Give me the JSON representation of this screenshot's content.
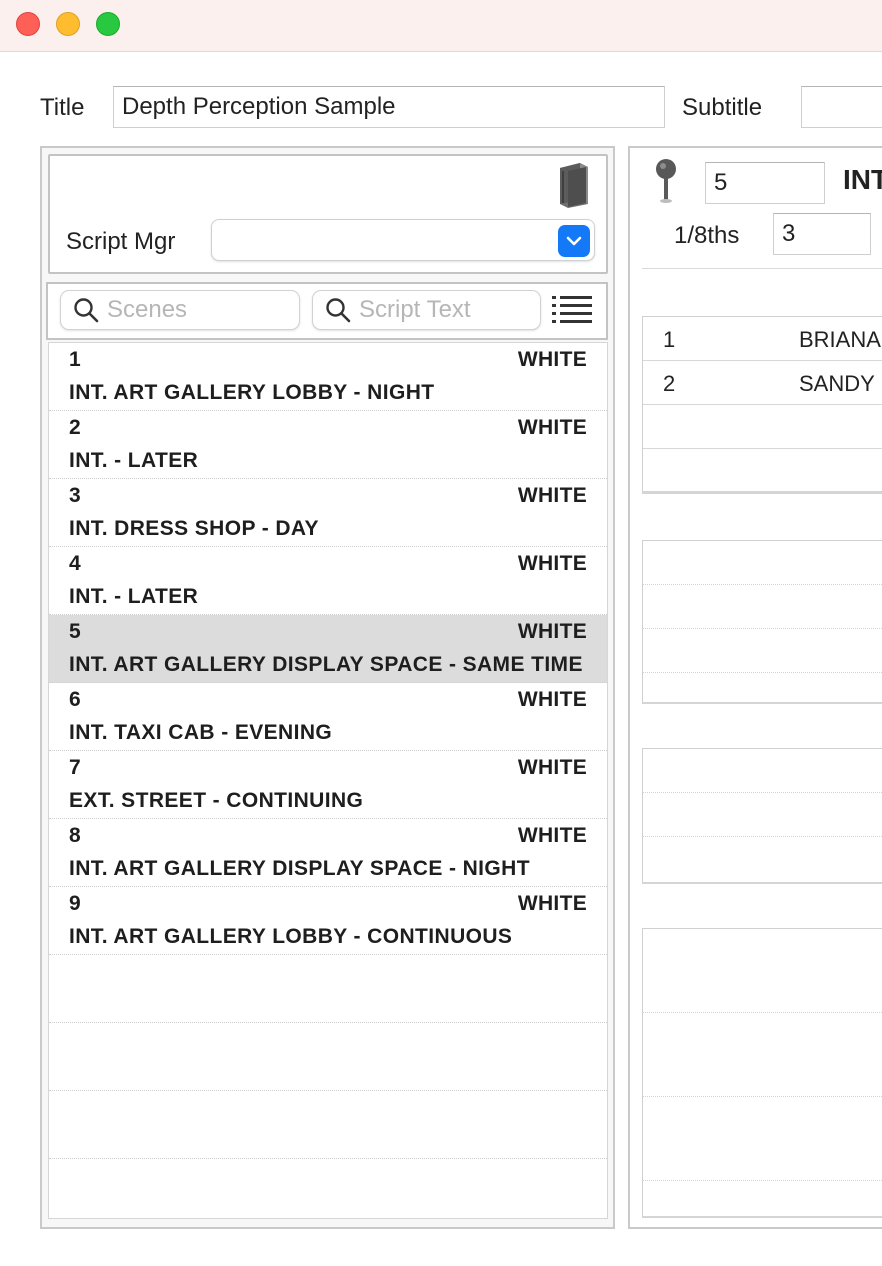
{
  "window": {
    "title_label": "Title",
    "title_value": "Depth Perception Sample",
    "subtitle_label": "Subtitle",
    "subtitle_value": ""
  },
  "script_manager": {
    "label": "Script Mgr",
    "selected": ""
  },
  "search": {
    "scenes_placeholder": "Scenes",
    "script_text_placeholder": "Script Text"
  },
  "scenes": [
    {
      "number": "1",
      "color": "WHITE",
      "heading": "INT. ART GALLERY LOBBY - NIGHT"
    },
    {
      "number": "2",
      "color": "WHITE",
      "heading": "INT.  - LATER"
    },
    {
      "number": "3",
      "color": "WHITE",
      "heading": "INT. DRESS SHOP - DAY"
    },
    {
      "number": "4",
      "color": "WHITE",
      "heading": "INT.  - LATER"
    },
    {
      "number": "5",
      "color": "WHITE",
      "heading": "INT. ART GALLERY DISPLAY SPACE - SAME TIME"
    },
    {
      "number": "6",
      "color": "WHITE",
      "heading": "INT. TAXI CAB - EVENING"
    },
    {
      "number": "7",
      "color": "WHITE",
      "heading": "EXT. STREET - CONTINUING"
    },
    {
      "number": "8",
      "color": "WHITE",
      "heading": "INT. ART GALLERY DISPLAY SPACE - NIGHT"
    },
    {
      "number": "9",
      "color": "WHITE",
      "heading": "INT. ART GALLERY LOBBY - CONTINUOUS"
    }
  ],
  "selected_scene_index": 4,
  "detail": {
    "scene_number": "5",
    "heading_partial": "INT",
    "eighths_label": "1/8ths",
    "eighths_value": "3",
    "cast": [
      {
        "number": "1",
        "name": "BRIANA"
      },
      {
        "number": "2",
        "name": "SANDY"
      }
    ]
  },
  "icons": {
    "book": "book-icon",
    "dropdown": "chevron-down-icon",
    "search": "search-icon",
    "list": "list-icon",
    "pin": "pin-icon"
  },
  "colors": {
    "accent": "#1479f6",
    "selected_row": "#dcdcdc"
  }
}
